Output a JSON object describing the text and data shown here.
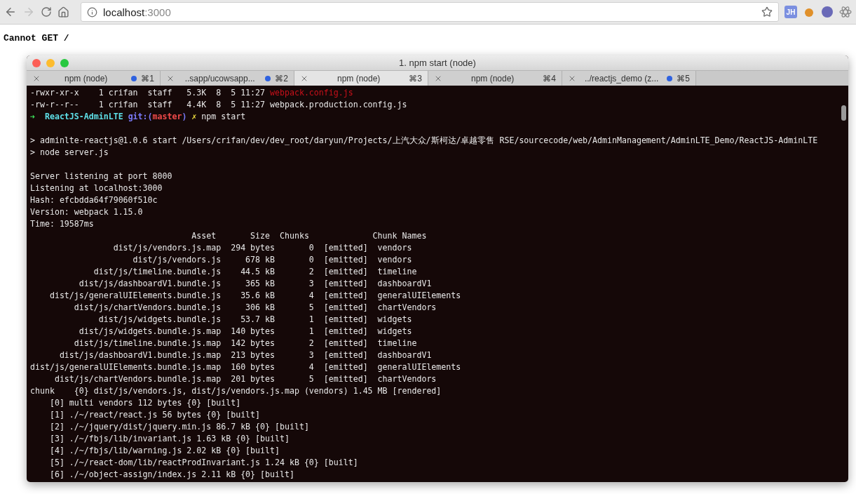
{
  "browser": {
    "url_host": "localhost",
    "url_port": ":3000",
    "extension_badge": "JH"
  },
  "page": {
    "message": "Cannot GET /"
  },
  "window": {
    "title": "1. npm start (node)"
  },
  "tabs": [
    {
      "label": "npm (node)",
      "shortcut": "⌘1",
      "activity": true,
      "selected": false
    },
    {
      "label": "..sapp/ucowsapp...",
      "shortcut": "⌘2",
      "activity": true,
      "selected": false
    },
    {
      "label": "npm (node)",
      "shortcut": "⌘3",
      "activity": false,
      "selected": true
    },
    {
      "label": "npm (node)",
      "shortcut": "⌘4",
      "activity": false,
      "selected": false
    },
    {
      "label": "../reactjs_demo (z...",
      "shortcut": "⌘5",
      "activity": true,
      "selected": false
    }
  ],
  "terminal_lines": [
    {
      "spaced": false,
      "segments": [
        {
          "kind": "plain",
          "text": "-rwxr-xr-x    1 crifan  staff   5.3K  8  5 11:27 "
        },
        {
          "kind": "red",
          "text": "webpack.config.js"
        }
      ]
    },
    {
      "spaced": false,
      "segments": [
        {
          "kind": "plain",
          "text": "-rw-r--r--    1 crifan  staff   4.4K  8  5 11:27 webpack.production.config.js"
        }
      ]
    },
    {
      "spaced": false,
      "segments": [
        {
          "kind": "arrow",
          "text": "➜  "
        },
        {
          "kind": "dir",
          "text": "ReactJS-AdminLTE "
        },
        {
          "kind": "git",
          "text": "git:("
        },
        {
          "kind": "branch",
          "text": "master"
        },
        {
          "kind": "git",
          "text": ") "
        },
        {
          "kind": "dirty",
          "text": "✗"
        },
        {
          "kind": "plain",
          "text": " npm start"
        }
      ]
    },
    {
      "spaced": true,
      "segments": [
        {
          "kind": "plain",
          "text": "> adminlte-reactjs@1.0.6 start /Users/crifan/dev/dev_root/daryun/Projects/上汽大众/斯柯达/卓越零售 RSE/sourcecode/web/AdminManagement/AdminLTE_Demo/ReactJS-AdminLTE"
        }
      ]
    },
    {
      "spaced": false,
      "segments": [
        {
          "kind": "plain",
          "text": "> node server.js"
        }
      ]
    },
    {
      "spaced": true,
      "segments": [
        {
          "kind": "plain",
          "text": "Server listening at port 8000"
        }
      ]
    },
    {
      "spaced": false,
      "segments": [
        {
          "kind": "plain",
          "text": "Listening at localhost:3000"
        }
      ]
    },
    {
      "spaced": false,
      "segments": [
        {
          "kind": "plain",
          "text": "Hash: efcbdda64f79060f510c"
        }
      ]
    },
    {
      "spaced": false,
      "segments": [
        {
          "kind": "plain",
          "text": "Version: webpack 1.15.0"
        }
      ]
    },
    {
      "spaced": false,
      "segments": [
        {
          "kind": "plain",
          "text": "Time: 19587ms"
        }
      ]
    },
    {
      "spaced": false,
      "segments": [
        {
          "kind": "plain",
          "text": "                                 Asset       Size  Chunks             Chunk Names"
        }
      ]
    },
    {
      "spaced": false,
      "segments": [
        {
          "kind": "plain",
          "text": "                 dist/js/vendors.js.map  294 bytes       0  [emitted]  vendors"
        }
      ]
    },
    {
      "spaced": false,
      "segments": [
        {
          "kind": "plain",
          "text": "                     dist/js/vendors.js     678 kB       0  [emitted]  vendors"
        }
      ]
    },
    {
      "spaced": false,
      "segments": [
        {
          "kind": "plain",
          "text": "             dist/js/timeline.bundle.js    44.5 kB       2  [emitted]  timeline"
        }
      ]
    },
    {
      "spaced": false,
      "segments": [
        {
          "kind": "plain",
          "text": "          dist/js/dashboardV1.bundle.js     365 kB       3  [emitted]  dashboardV1"
        }
      ]
    },
    {
      "spaced": false,
      "segments": [
        {
          "kind": "plain",
          "text": "    dist/js/generalUIElements.bundle.js    35.6 kB       4  [emitted]  generalUIElements"
        }
      ]
    },
    {
      "spaced": false,
      "segments": [
        {
          "kind": "plain",
          "text": "         dist/js/chartVendors.bundle.js     306 kB       5  [emitted]  chartVendors"
        }
      ]
    },
    {
      "spaced": false,
      "segments": [
        {
          "kind": "plain",
          "text": "              dist/js/widgets.bundle.js    53.7 kB       1  [emitted]  widgets"
        }
      ]
    },
    {
      "spaced": false,
      "segments": [
        {
          "kind": "plain",
          "text": "          dist/js/widgets.bundle.js.map  140 bytes       1  [emitted]  widgets"
        }
      ]
    },
    {
      "spaced": false,
      "segments": [
        {
          "kind": "plain",
          "text": "         dist/js/timeline.bundle.js.map  142 bytes       2  [emitted]  timeline"
        }
      ]
    },
    {
      "spaced": false,
      "segments": [
        {
          "kind": "plain",
          "text": "      dist/js/dashboardV1.bundle.js.map  213 bytes       3  [emitted]  dashboardV1"
        }
      ]
    },
    {
      "spaced": false,
      "segments": [
        {
          "kind": "plain",
          "text": "dist/js/generalUIElements.bundle.js.map  160 bytes       4  [emitted]  generalUIElements"
        }
      ]
    },
    {
      "spaced": false,
      "segments": [
        {
          "kind": "plain",
          "text": "     dist/js/chartVendors.bundle.js.map  201 bytes       5  [emitted]  chartVendors"
        }
      ]
    },
    {
      "spaced": false,
      "segments": [
        {
          "kind": "plain",
          "text": "chunk    {0} dist/js/vendors.js, dist/js/vendors.js.map (vendors) 1.45 MB [rendered]"
        }
      ]
    },
    {
      "spaced": false,
      "segments": [
        {
          "kind": "plain",
          "text": "    [0] multi vendors 112 bytes {0} [built]"
        }
      ]
    },
    {
      "spaced": false,
      "segments": [
        {
          "kind": "plain",
          "text": "    [1] ./~/react/react.js 56 bytes {0} [built]"
        }
      ]
    },
    {
      "spaced": false,
      "segments": [
        {
          "kind": "plain",
          "text": "    [2] ./~/jquery/dist/jquery.min.js 86.7 kB {0} [built]"
        }
      ]
    },
    {
      "spaced": false,
      "segments": [
        {
          "kind": "plain",
          "text": "    [3] ./~/fbjs/lib/invariant.js 1.63 kB {0} [built]"
        }
      ]
    },
    {
      "spaced": false,
      "segments": [
        {
          "kind": "plain",
          "text": "    [4] ./~/fbjs/lib/warning.js 2.02 kB {0} [built]"
        }
      ]
    },
    {
      "spaced": false,
      "segments": [
        {
          "kind": "plain",
          "text": "    [5] ./~/react-dom/lib/reactProdInvariant.js 1.24 kB {0} [built]"
        }
      ]
    },
    {
      "spaced": false,
      "segments": [
        {
          "kind": "plain",
          "text": "    [6] ./~/object-assign/index.js 2.11 kB {0} [built]"
        }
      ]
    }
  ]
}
